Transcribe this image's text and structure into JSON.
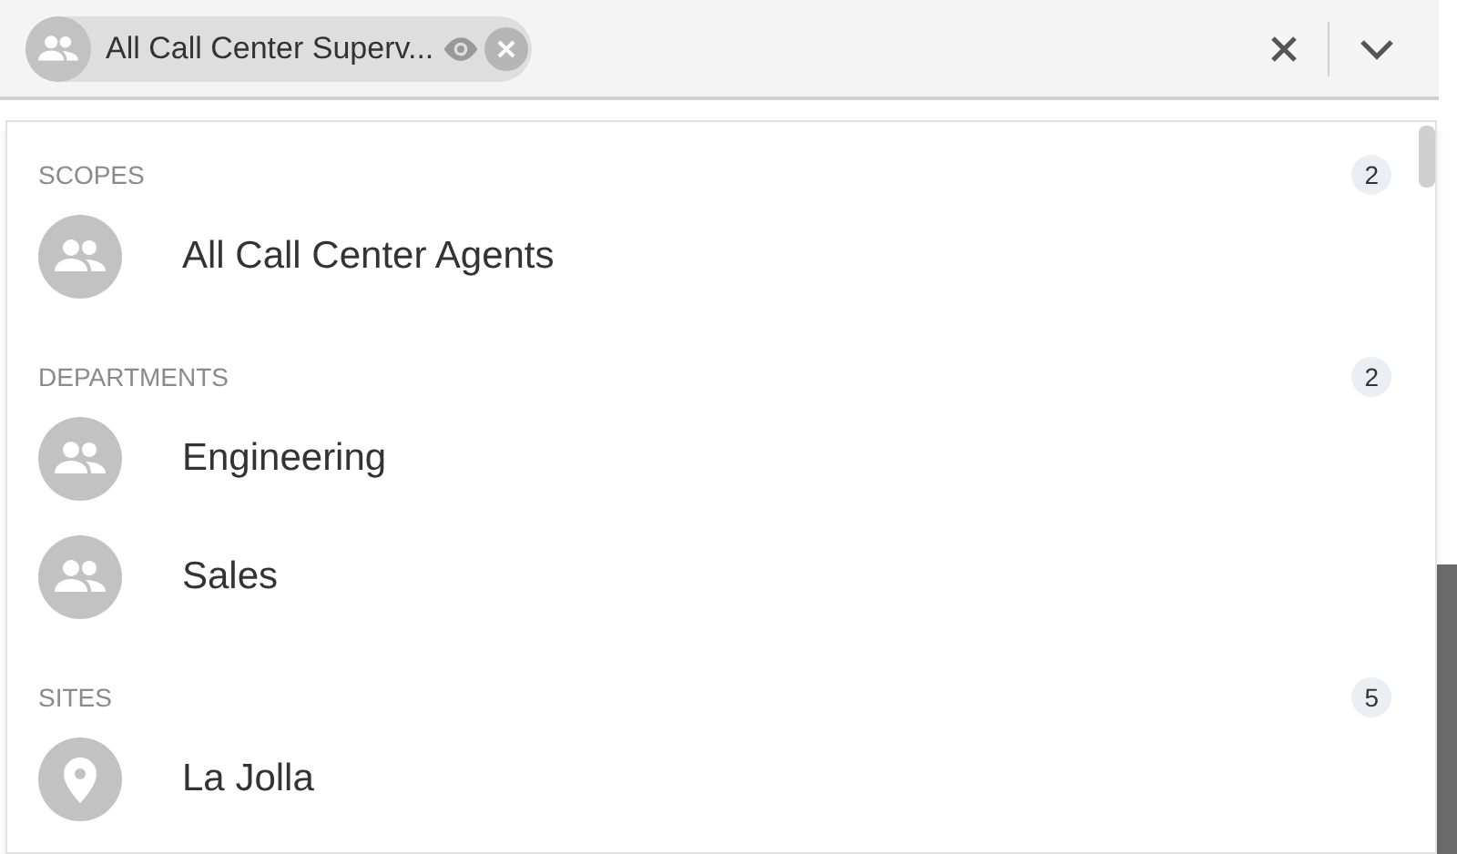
{
  "selection": {
    "chip": {
      "label": "All Call Center Superv...",
      "kind": "group"
    }
  },
  "groups": [
    {
      "title": "SCOPES",
      "count": "2",
      "items": [
        {
          "label": "All Call Center Agents",
          "kind": "group"
        }
      ]
    },
    {
      "title": "DEPARTMENTS",
      "count": "2",
      "items": [
        {
          "label": "Engineering",
          "kind": "group"
        },
        {
          "label": "Sales",
          "kind": "group"
        }
      ]
    },
    {
      "title": "SITES",
      "count": "5",
      "items": [
        {
          "label": "La Jolla",
          "kind": "pin"
        }
      ]
    }
  ]
}
